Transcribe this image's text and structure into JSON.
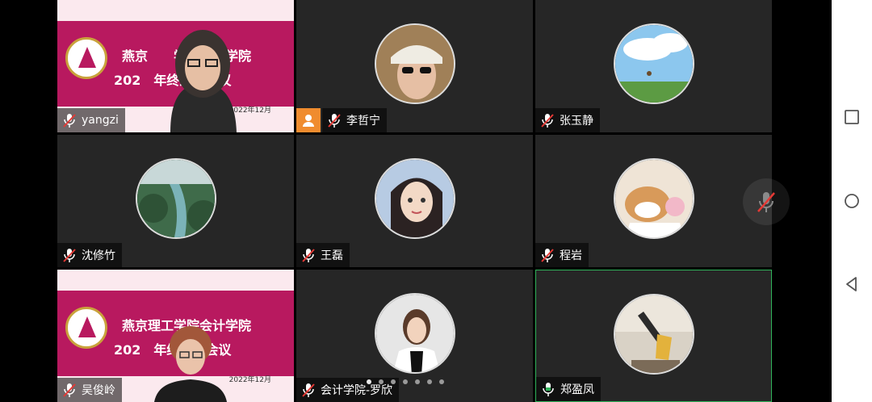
{
  "participants": [
    {
      "name": "yangzi",
      "type": "slide",
      "muted": true
    },
    {
      "name": "李哲宁",
      "type": "avatar",
      "muted": true,
      "host": true,
      "avatar_color": "#c9a46a"
    },
    {
      "name": "张玉静",
      "type": "avatar",
      "muted": true,
      "avatar_color": "#8cc7ee"
    },
    {
      "name": "沈修竹",
      "type": "avatar",
      "muted": true,
      "avatar_color": "#4f7a5c"
    },
    {
      "name": "王磊",
      "type": "avatar",
      "muted": true,
      "avatar_color": "#9fb8d6"
    },
    {
      "name": "程岩",
      "type": "avatar",
      "muted": true,
      "avatar_color": "#e9d8c4"
    },
    {
      "name": "吴俊岭",
      "type": "slide",
      "muted": true
    },
    {
      "name": "会计学院-罗欣",
      "type": "avatar",
      "muted": true,
      "avatar_color": "#d8d8d8"
    },
    {
      "name": "郑盈凤",
      "type": "avatar",
      "muted": false,
      "speaking": true,
      "avatar_color": "#a59a8a"
    }
  ],
  "slide": {
    "title_line1": "燕京理工学院会计学院",
    "title_line2": "2022年终述职会议",
    "title_line1_partial": "燕京　　学院会计学院",
    "title_line2_partial": "202　年终述职会议",
    "date": "2022年12月"
  },
  "pager": {
    "pages": 7,
    "current": 1
  },
  "colors": {
    "accent_speaking": "#2fb35a",
    "host_badge": "#f08c2e",
    "slide_bg": "#b8195f",
    "mute_red": "#e53935"
  },
  "icons": [
    "mic-muted-icon",
    "mic-icon",
    "host-icon",
    "square-icon",
    "circle-icon",
    "back-triangle-icon"
  ]
}
